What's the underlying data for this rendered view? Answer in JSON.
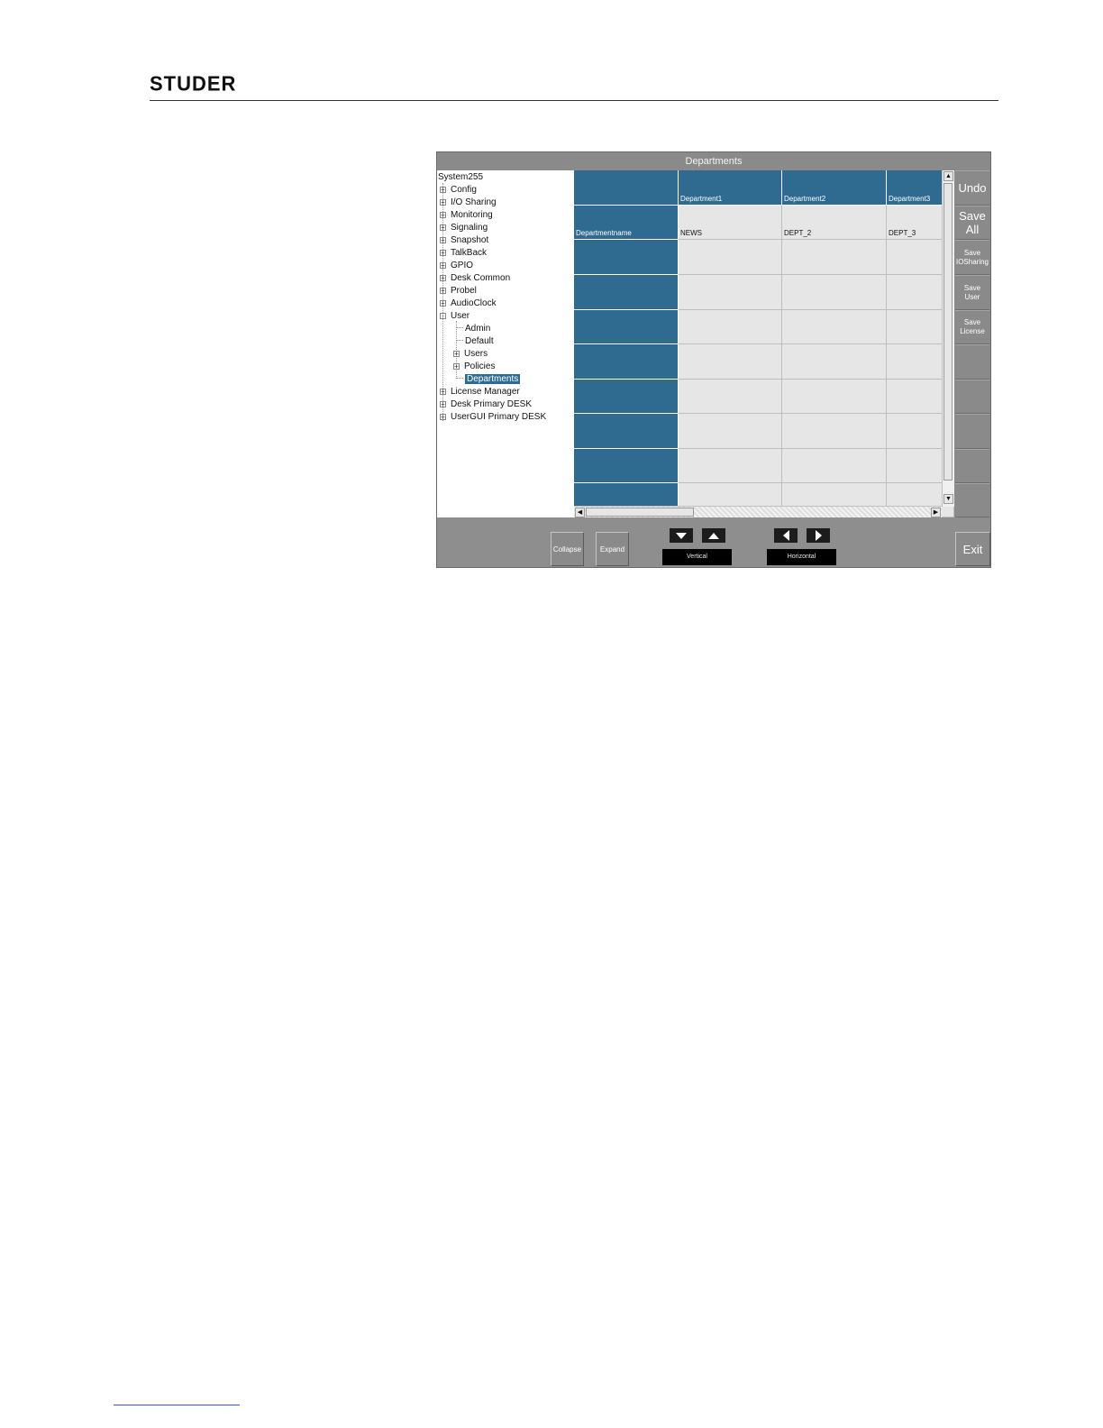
{
  "header": {
    "logo_text": "STUDER"
  },
  "window": {
    "title": "Departments"
  },
  "tree": {
    "root": "System255",
    "items": [
      {
        "label": "Config",
        "expander": "+"
      },
      {
        "label": "I/O Sharing",
        "expander": "+"
      },
      {
        "label": "Monitoring",
        "expander": "+"
      },
      {
        "label": "Signaling",
        "expander": "+"
      },
      {
        "label": "Snapshot",
        "expander": "+"
      },
      {
        "label": "TalkBack",
        "expander": "+"
      },
      {
        "label": "GPIO",
        "expander": "+"
      },
      {
        "label": "Desk Common",
        "expander": "+"
      },
      {
        "label": "Probel",
        "expander": "+"
      },
      {
        "label": "AudioClock",
        "expander": "+"
      },
      {
        "label": "User",
        "expander": "-"
      },
      {
        "label": "Admin",
        "expander": ""
      },
      {
        "label": "Default",
        "expander": ""
      },
      {
        "label": "Users",
        "expander": "+"
      },
      {
        "label": "Policies",
        "expander": "+"
      },
      {
        "label": "Departments",
        "expander": "",
        "selected": true
      },
      {
        "label": "License Manager",
        "expander": "+"
      },
      {
        "label": "Desk Primary DESK",
        "expander": "+"
      },
      {
        "label": "UserGUI Primary DESK",
        "expander": "+"
      }
    ]
  },
  "grid": {
    "columns": [
      "Department1",
      "Department2",
      "Department3"
    ],
    "row_header": "Departmentname",
    "values": [
      "NEWS",
      "DEPT_2",
      "DEPT_3"
    ]
  },
  "side_buttons": {
    "undo": "Undo",
    "save_all_1": "Save",
    "save_all_2": "All",
    "save_iosharing_1": "Save",
    "save_iosharing_2": "IOSharing",
    "save_user_1": "Save",
    "save_user_2": "User",
    "save_license_1": "Save",
    "save_license_2": "License"
  },
  "bottom": {
    "collapse": "Collapse",
    "expand": "Expand",
    "vertical_label": "Vertical",
    "horizontal_label": "Horizontal",
    "exit": "Exit"
  },
  "colors": {
    "header_blue": "#2f6a90",
    "panel_gray": "#8a8a8a",
    "cell_gray": "#e6e6e6"
  }
}
